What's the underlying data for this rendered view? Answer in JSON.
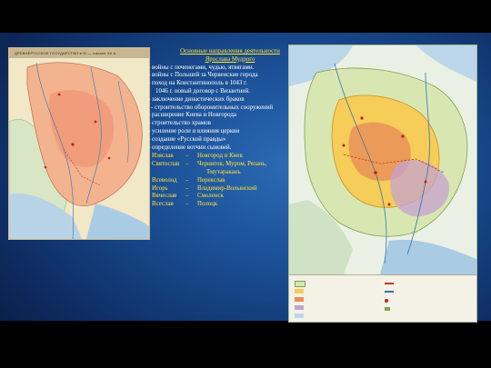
{
  "left_map": {
    "header": "ДРЕВНЕРУССКОЕ ГОСУДАРСТВО в XI — начале XII в."
  },
  "text": {
    "title_line1": "Основные направления деятельности",
    "title_line2": "Ярослава Мудрого",
    "items": [
      "- войны с печенегами, чудью, ятвягами.",
      "- войны с Польшей за Червенские города",
      "- поход на Константинополь в 1043 г.",
      "1046 г. новый договор с Византией.",
      "- заключение династических браков",
      " - строительство оборонительных сооружений",
      "- расширение Киева и Новгорода",
      "- строительство храмов",
      "- усиление роли и влияния церкви",
      "- создание «Русской правды»",
      "- определение вотчин сыновей."
    ],
    "sons": [
      {
        "name": "Изяслав",
        "dash": "–",
        "lands": "Новгород и Киев"
      },
      {
        "name": "Святослав",
        "dash": "–",
        "lands": "Чернигов, Муром, Рязань,"
      },
      {
        "name": "",
        "dash": "",
        "lands": "Тмутаракань"
      },
      {
        "name": "Всеволод",
        "dash": "–",
        "lands": "Переяслав"
      },
      {
        "name": "Игорь",
        "dash": "–",
        "lands": "Владимир-Волынский"
      },
      {
        "name": "Вячеслав",
        "dash": "–",
        "lands": "Смоленск"
      },
      {
        "name": "Всеслав",
        "dash": "–",
        "lands": "Полоцк"
      }
    ]
  },
  "colors": {
    "title": "#ffe23b",
    "body_text": "#ffffff",
    "background": "#1a4f95"
  }
}
